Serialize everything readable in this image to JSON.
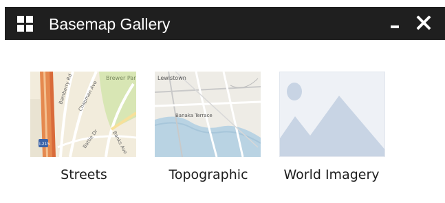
{
  "window": {
    "title": "Basemap Gallery",
    "icon": "grid-icon",
    "controls": [
      "minimize-icon",
      "close-icon"
    ]
  },
  "basemaps": [
    {
      "label": "Streets",
      "map_text": [
        "Bamberry Rd",
        "Chapman Ave",
        "Brewer Park",
        "Banks Ave",
        "Battle Dr",
        "I-215"
      ]
    },
    {
      "label": "Topographic",
      "map_text": [
        "Lewistown",
        "Banaka Terrace"
      ]
    },
    {
      "label": "World Imagery",
      "placeholder_icon": "image-placeholder-icon"
    }
  ],
  "colors": {
    "titlebar_bg": "#1f1f1f",
    "titlebar_fg": "#ffffff",
    "placeholder_bg": "#eef1f6",
    "placeholder_shape": "#c8d4e4"
  }
}
